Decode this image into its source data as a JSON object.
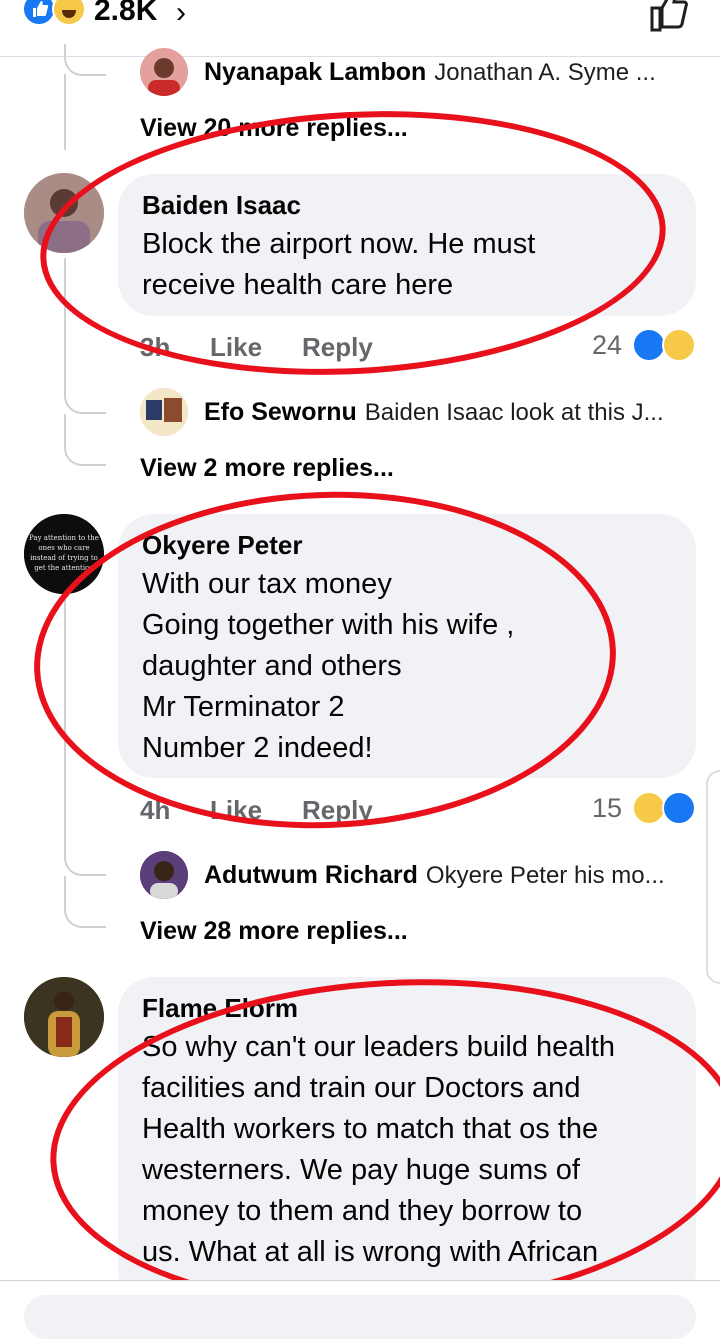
{
  "top": {
    "reaction_count": "2.8K"
  },
  "threads": [
    {
      "reply_preview": {
        "name": "Nyanapak Lambon",
        "text": "Jonathan A. Syme ..."
      },
      "view_more": "View 20 more replies..."
    },
    {
      "author": "Baiden Isaac",
      "text": "Block the airport now. He must\nreceive health care here",
      "time": "3h",
      "like_label": "Like",
      "reply_label": "Reply",
      "reaction_count": "24",
      "reply_preview": {
        "name": "Efo Sewornu",
        "text": "Baiden Isaac look at this J..."
      },
      "view_more": "View 2 more replies..."
    },
    {
      "author": "Okyere Peter",
      "text": "With our tax money\nGoing together with his wife ,\ndaughter and others\nMr Terminator 2\nNumber 2 indeed!",
      "time": "4h",
      "like_label": "Like",
      "reply_label": "Reply",
      "reaction_count": "15",
      "avatar_text": "Pay attention to the ones who care instead of trying to get the attention of those who don't",
      "reply_preview": {
        "name": "Adutwum Richard",
        "text": "Okyere Peter  his mo..."
      },
      "view_more": "View 28 more replies..."
    },
    {
      "author": "Flame Elorm",
      "text": "So why can't our leaders build health\nfacilities and train our Doctors and\nHealth workers to match that os the\nwesterners. We pay huge sums of\nmoney to them and they borrow to\nus. What at all is wrong with African"
    }
  ],
  "colors": {
    "accent": "#1877f2",
    "annotation": "#e8101b",
    "bubble": "#f0f2f5",
    "muted": "#65676b"
  }
}
